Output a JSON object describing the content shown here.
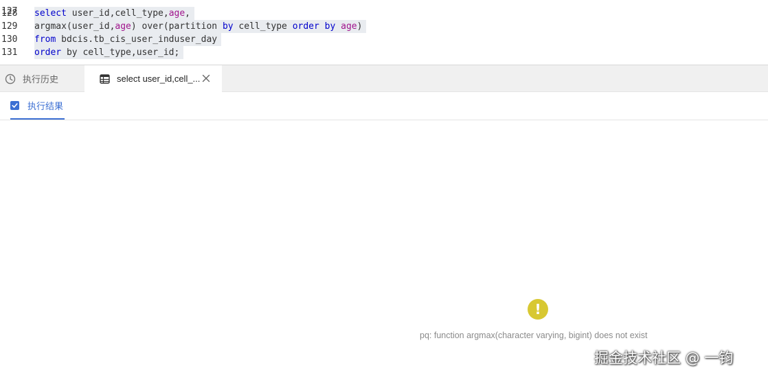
{
  "editor": {
    "cut_line_number": "127",
    "lines": [
      {
        "num": "128",
        "tokens": [
          [
            "kw",
            "select"
          ],
          [
            "t",
            " user_id,cell_type,"
          ],
          [
            "id",
            "age"
          ],
          [
            "t",
            ","
          ]
        ]
      },
      {
        "num": "129",
        "tokens": [
          [
            "t",
            "argmax(user_id,"
          ],
          [
            "id",
            "age"
          ],
          [
            "t",
            ") over(partition "
          ],
          [
            "kw",
            "by"
          ],
          [
            "t",
            " cell_type "
          ],
          [
            "kw",
            "order"
          ],
          [
            "t",
            " "
          ],
          [
            "kw",
            "by"
          ],
          [
            "t",
            " "
          ],
          [
            "id",
            "age"
          ],
          [
            "t",
            ")"
          ]
        ]
      },
      {
        "num": "130",
        "tokens": [
          [
            "kw",
            "from"
          ],
          [
            "t",
            " bdcis.tb_cis_user_induser_day"
          ]
        ]
      },
      {
        "num": "131",
        "tokens": [
          [
            "kw",
            "order"
          ],
          [
            "t",
            " by cell_type,user_id;"
          ]
        ]
      }
    ]
  },
  "tabs": {
    "history_label": "执行历史",
    "query_label": "select user_id,cell_..."
  },
  "subtab": {
    "result_label": "执行结果"
  },
  "error": {
    "icon_text": "!",
    "message": "pq: function argmax(character varying, bigint) does not exist"
  },
  "watermark": "掘金技术社区 @ 一钧",
  "colors": {
    "keyword": "#0000cc",
    "identifier": "#a0148c",
    "accent": "#3b6fd3",
    "warning": "#d8c832"
  },
  "icons": {
    "history": "clock-icon",
    "query": "table-icon",
    "close": "close-icon",
    "result": "checkbox-icon",
    "error": "warning-icon"
  }
}
